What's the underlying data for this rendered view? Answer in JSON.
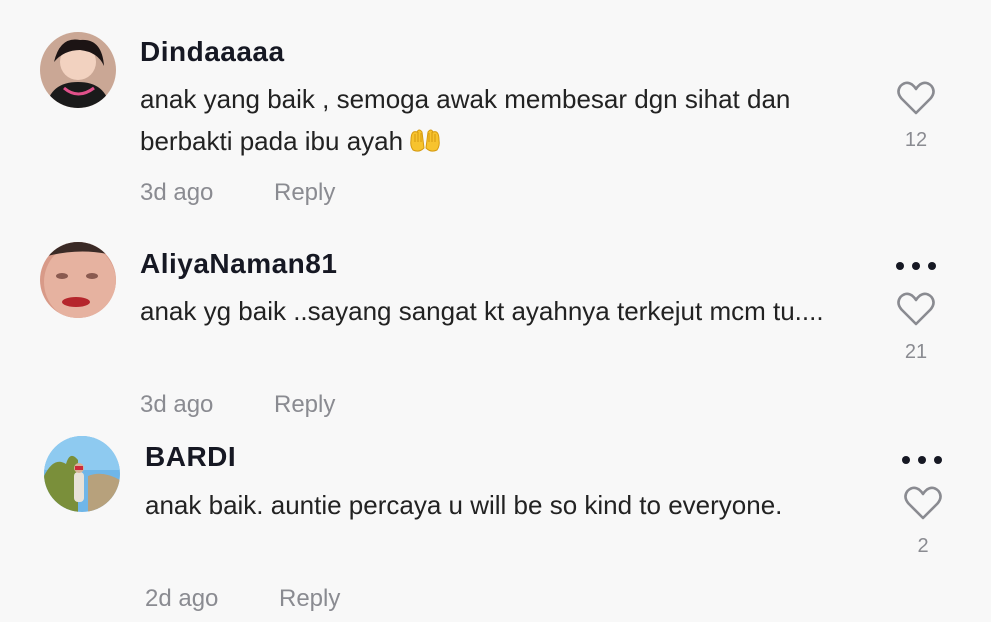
{
  "comments": [
    {
      "username": "Dindaaaaa",
      "text": "anak yang baik , semoga awak membesar dgn sihat dan berbakti pada ibu ayah",
      "emoji": "palms-up-together",
      "time": "3d ago",
      "reply_label": "Reply",
      "likes": "12",
      "avatar_icon": "user-avatar-photo"
    },
    {
      "username": "AliyaNaman81",
      "text": "anak yg baik ..sayang sangat kt ayahnya terkejut mcm tu....",
      "time": "3d ago",
      "reply_label": "Reply",
      "likes": "21",
      "avatar_icon": "user-avatar-photo"
    },
    {
      "username": "BARDI",
      "text": "anak baik. auntie percaya u will be so kind to everyone.",
      "time": "2d ago",
      "reply_label": "Reply",
      "likes": "2",
      "avatar_icon": "user-avatar-photo"
    }
  ],
  "colors": {
    "background": "#f8f8f8",
    "text": "#161823",
    "muted": "#8a8b91"
  },
  "icons": {
    "like": "heart-outline-icon",
    "more": "more-options-icon"
  }
}
